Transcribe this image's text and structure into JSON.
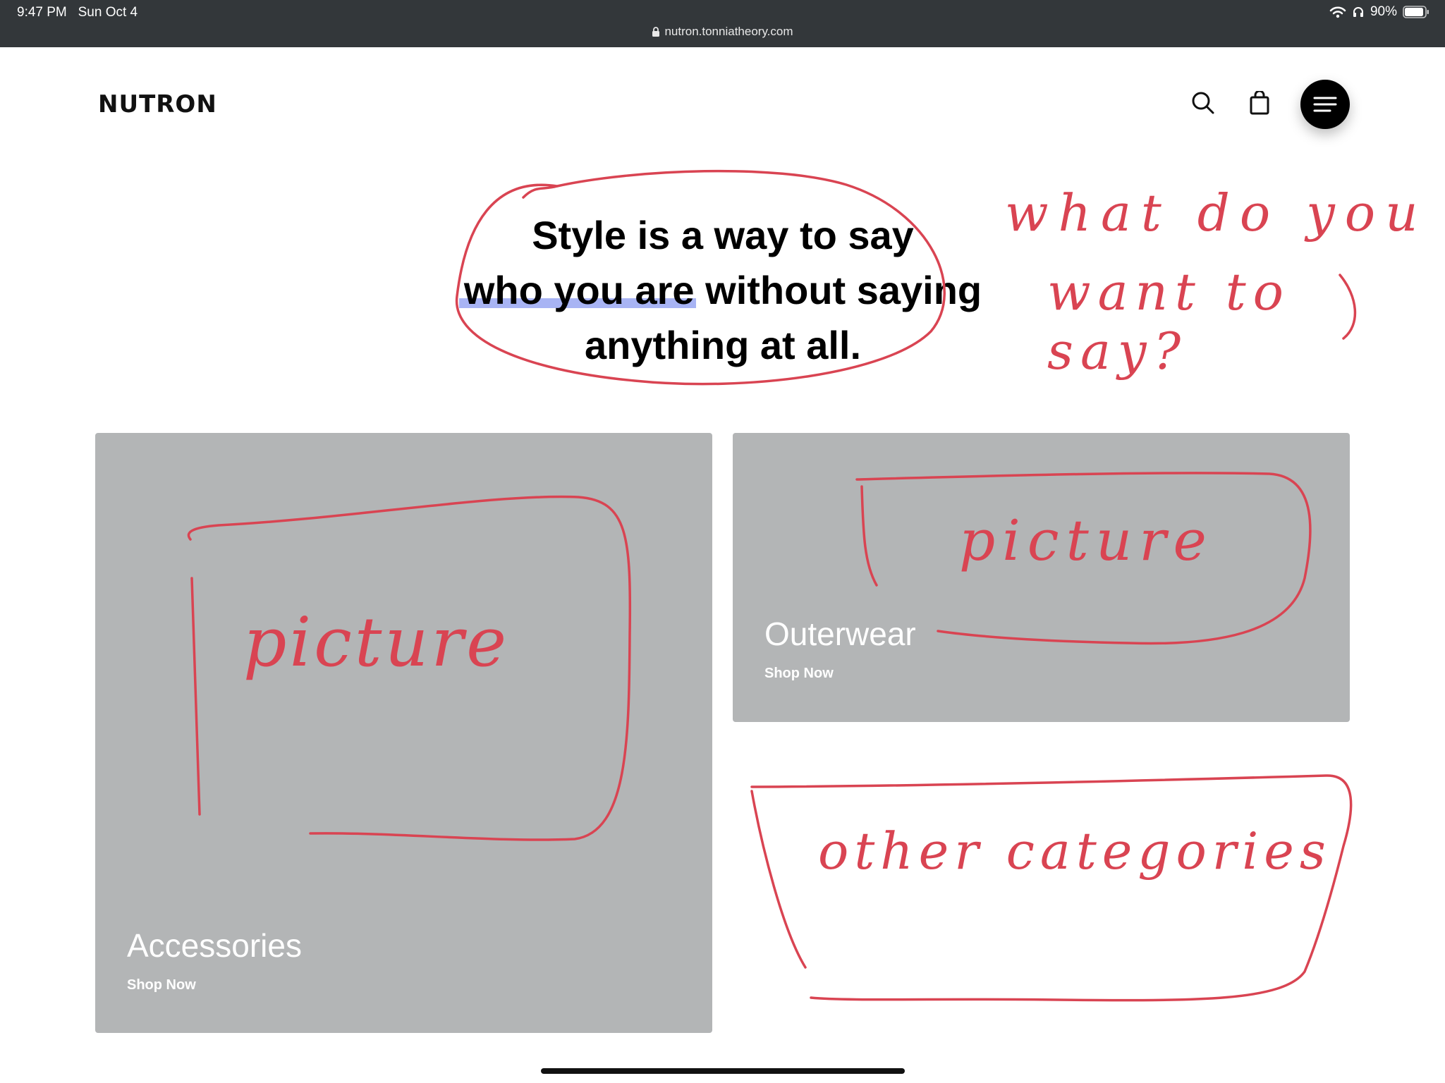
{
  "status_bar": {
    "time": "9:47 PM",
    "date": "Sun Oct 4",
    "battery": "90%",
    "url": "nutron.tonniatheory.com"
  },
  "header": {
    "logo": "NUTRON",
    "icons": [
      "search-icon",
      "shopping-bag-icon",
      "menu-icon"
    ]
  },
  "hero": {
    "lines": [
      "Style is a way to say",
      "who you are without saying",
      "anything at all."
    ]
  },
  "categories": [
    {
      "title": "Accessories",
      "link": "Shop Now"
    },
    {
      "title": "Outerwear",
      "link": "Shop Now"
    }
  ],
  "annotations": {
    "question_line1": "what do you",
    "question_line2": "want to say?",
    "picture_large": "picture",
    "picture_small": "picture",
    "other": "other categories"
  },
  "colors": {
    "status_bar": "#33373a",
    "card": "#b3b5b6",
    "ink": "#d94452",
    "highlight": "#a8b4f4"
  }
}
